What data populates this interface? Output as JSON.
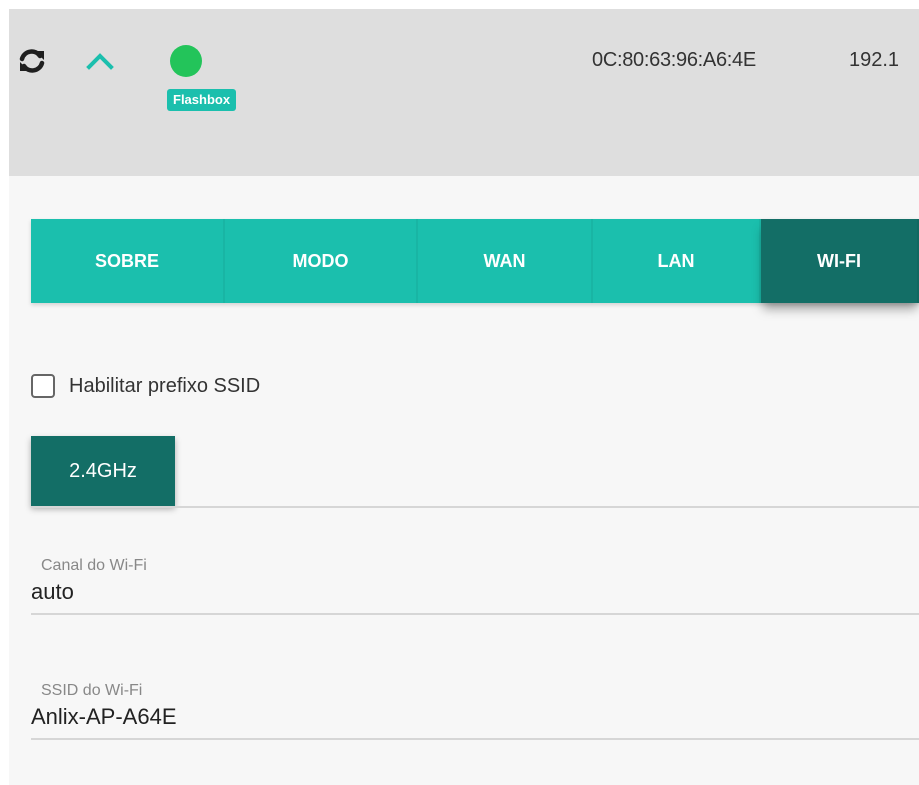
{
  "colors": {
    "accent": "#1bbfad",
    "accent_dark": "#136e66",
    "status_online": "#23c45a",
    "header_bg": "#dedede",
    "page_bg": "#f7f7f7"
  },
  "header": {
    "refresh_icon": "refresh-icon",
    "collapse_icon": "chevron-up-icon",
    "status": "online",
    "device_badge": "Flashbox",
    "mac_address": "0C:80:63:96:A6:4E",
    "ip_address": "192.1"
  },
  "tabs": [
    {
      "label": "SOBRE",
      "active": false
    },
    {
      "label": "MODO",
      "active": false
    },
    {
      "label": "WAN",
      "active": false
    },
    {
      "label": "LAN",
      "active": false
    },
    {
      "label": "WI-FI",
      "active": true
    }
  ],
  "ssid_prefix": {
    "label": "Habilitar prefixo SSID",
    "checked": false
  },
  "band": {
    "label": "2.4GHz"
  },
  "fields": {
    "channel": {
      "label": "Canal do Wi-Fi",
      "value": "auto"
    },
    "ssid": {
      "label": "SSID do Wi-Fi",
      "value": "Anlix-AP-A64E"
    }
  }
}
